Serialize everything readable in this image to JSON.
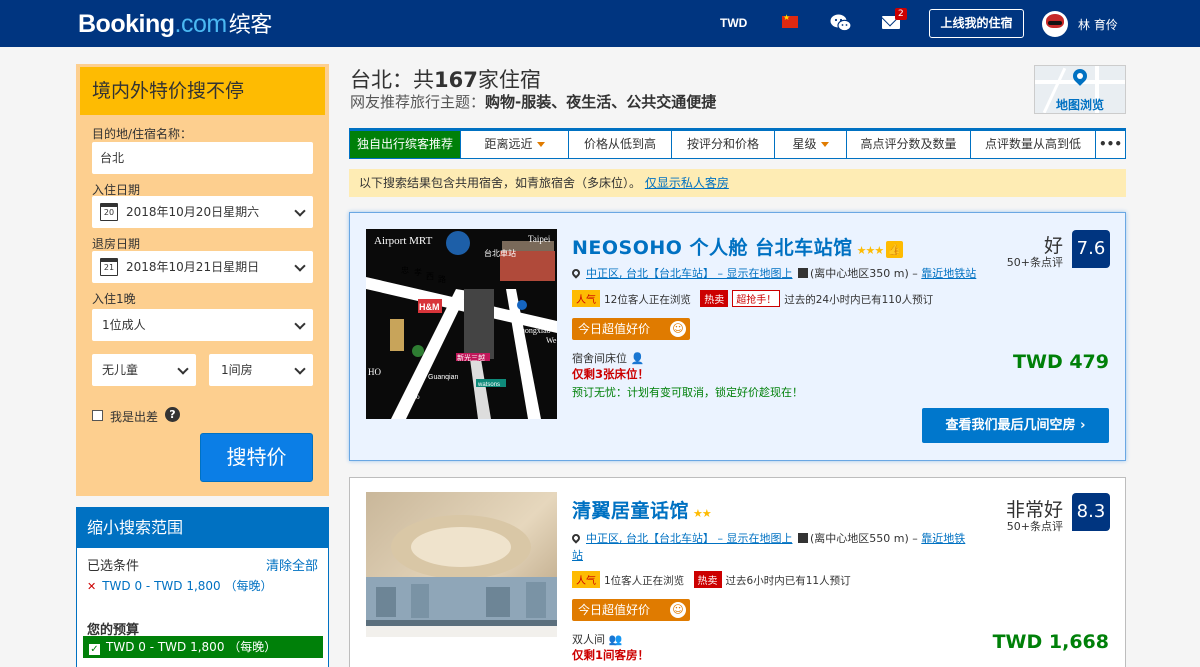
{
  "header": {
    "logo_main": "Booking",
    "logo_dot": ".com",
    "logo_cn": "缤客",
    "currency": "TWD",
    "mail_count": "2",
    "list_property": "上线我的住宿",
    "username": "林 育伶"
  },
  "search": {
    "title": "境内外特价搜不停",
    "dest_label": "目的地/住宿名称：",
    "dest_value": "台北",
    "checkin_label": "入住日期",
    "checkin_day": "20",
    "checkin_value": "2018年10月20日星期六",
    "checkout_label": "退房日期",
    "checkout_day": "21",
    "checkout_value": "2018年10月21日星期日",
    "nights_label": "入住1晚",
    "adults": "1位成人",
    "children": "无儿童",
    "rooms": "1间房",
    "business_label": "我是出差",
    "help": "?",
    "submit": "搜特价"
  },
  "filters": {
    "title": "缩小搜索范围",
    "selected_label": "已选条件",
    "clear": "清除全部",
    "selected_item": "TWD 0 - TWD 1,800 （每晚）",
    "budget_label": "您的预算",
    "budget_item": "TWD 0 - TWD 1,800 （每晚）"
  },
  "results": {
    "title_prefix": "台北：共",
    "title_count": "167",
    "title_suffix": "家住宿",
    "subtitle_prefix": "网友推荐旅行主题：",
    "subtitle_themes": "购物-服装、夜生活、公共交通便捷",
    "map_label": "地图浏览"
  },
  "sort_tabs": [
    {
      "label": "独自出行缤客推荐",
      "active": true,
      "arrow": false
    },
    {
      "label": "距离远近",
      "active": false,
      "arrow": true
    },
    {
      "label": "价格从低到高",
      "active": false,
      "arrow": false
    },
    {
      "label": "按评分和价格",
      "active": false,
      "arrow": false
    },
    {
      "label": "星级",
      "active": false,
      "arrow": true
    },
    {
      "label": "高点评分数及数量",
      "active": false,
      "arrow": false
    },
    {
      "label": "点评数量从高到低",
      "active": false,
      "arrow": false
    },
    {
      "label": "•••",
      "active": false,
      "arrow": false
    }
  ],
  "notice": {
    "text": "以下搜索结果包含共用宿舍，如青旅宿舍（多床位）。",
    "link": "仅显示私人客房"
  },
  "hotels": [
    {
      "name": "NEOSOHO 个人舱 台北车站馆",
      "stars": "★★★",
      "thumb": "👍",
      "loc_link": "中正区, 台北【台北车站】 – 显示在地图上",
      "loc_distance": "(离中心地区350 m) – ",
      "loc_metro": "靠近地铁站",
      "tag_pop": "人气",
      "viewing": "12位客人正在浏览",
      "tag_hot": "热卖",
      "tag_grab": "超抢手！",
      "booked": "过去的24小时内已有110人预订",
      "deal": "今日超值好价",
      "room": "宿舍间床位",
      "left": "仅剩3张床位！",
      "cancel": "预订无忧：计划有变可取消，锁定好价趁现在！",
      "score_word": "好",
      "score_reviews": "50+条点评",
      "score": "7.6",
      "price": "TWD 479",
      "cta": "查看我们最后几间空房 ›",
      "photo_texts": [
        "Airport MRT",
        "台北車站",
        "Taipei",
        "忠",
        "孝",
        "西",
        "路",
        "H&M",
        "Zhongxiao",
        "We",
        "HO",
        "新光三越",
        "Guanqian",
        "watsons",
        "Roo"
      ]
    },
    {
      "name": "清翼居童话馆",
      "stars": "★★",
      "loc_link": "中正区, 台北【台北车站】 – 显示在地图上",
      "loc_distance": "(离中心地区550 m) – ",
      "loc_metro": "靠近地铁",
      "loc_metro2": "站",
      "tag_pop": "人气",
      "viewing": "1位客人正在浏览",
      "tag_hot": "热卖",
      "booked": "过去6小时内已有11人预订",
      "deal": "今日超值好价",
      "room": "双人间",
      "left": "仅剩1间客房！",
      "score_word": "非常好",
      "score_reviews": "50+条点评",
      "score": "8.3",
      "price": "TWD 1,668"
    }
  ]
}
